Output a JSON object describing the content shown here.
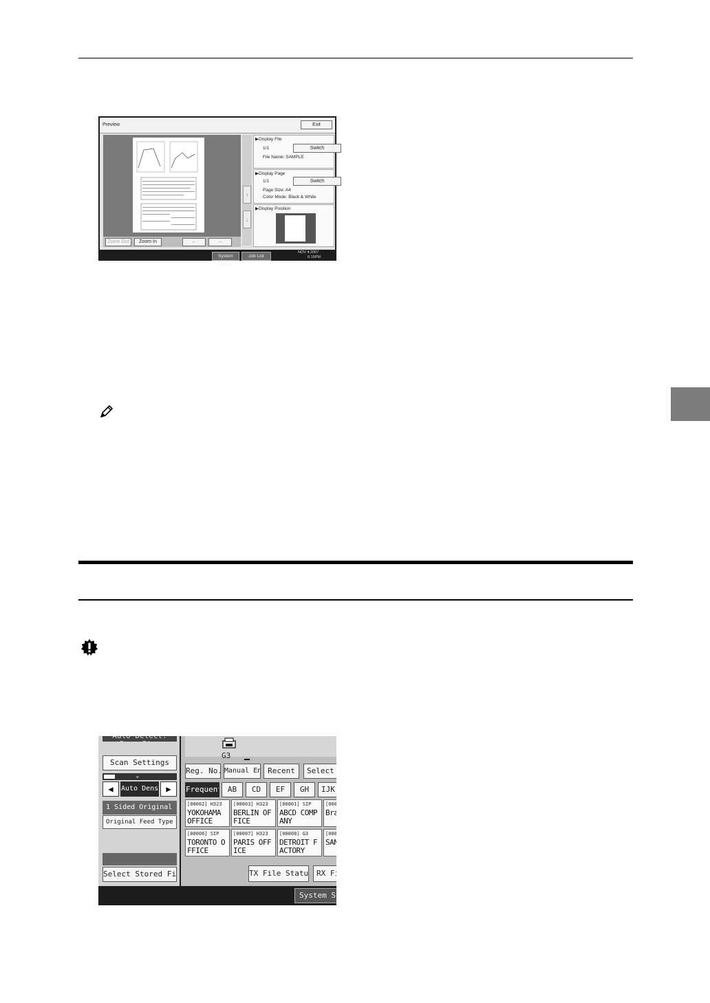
{
  "preview_screen": {
    "title": "Preview",
    "exit_label": "Exit",
    "zoom_out_label": "Zoom Out",
    "zoom_in_label": "Zoom In",
    "prev_arrow": "←",
    "next_arrow": "→",
    "scroll_up": "↑",
    "scroll_down": "↓",
    "display_file": {
      "heading": "Display File",
      "count": "1/1",
      "file_name_label": "File Name:",
      "file_name": "SAMPLE",
      "switch_label": "Switch"
    },
    "display_page": {
      "heading": "Display Page",
      "count": "1/1",
      "page_size_label": "Page Size:",
      "page_size": "A4",
      "color_mode_label": "Color Mode:",
      "color_mode": "Black & White",
      "switch_label": "Switch"
    },
    "display_position": {
      "heading": "Display Position"
    },
    "status_bar": {
      "system_status": "System Status",
      "job_list": "Job List",
      "date": "NOV  4,2007",
      "time": "6:15PM"
    }
  },
  "fax_screen": {
    "top_text": "Auto Detect: Same Size",
    "scan_settings": "Scan Settings",
    "auto_density": "Auto Density",
    "sided_original": "1 Sided Original",
    "original_feed_type": "Original Feed Type",
    "select_stored_file": "Select Stored File",
    "line_mode": "G3",
    "tabs": {
      "reg_no": "Reg. No.",
      "manual_entry": "Manual Entry",
      "recent": "Recent",
      "select_line": "Select Line"
    },
    "index": [
      "Frequent",
      "AB",
      "CD",
      "EF",
      "GH",
      "IJK"
    ],
    "destinations": [
      {
        "code": "[00002] H323",
        "name": "YOKOHAMA OFFICE"
      },
      {
        "code": "[00003] H323",
        "name": "BERLIN OFFICE"
      },
      {
        "code": "[00001] SIP",
        "name": "ABCD COMPANY"
      },
      {
        "code": "[0000",
        "name": "Bra"
      },
      {
        "code": "[00006] SIP",
        "name": "TORONTO OFFICE"
      },
      {
        "code": "[00007] H323",
        "name": "PARIS OFFICE"
      },
      {
        "code": "[00008] G3",
        "name": "DETROIT FACTORY"
      },
      {
        "code": "[0000",
        "name": "SANSCO"
      }
    ],
    "tx_file_status": "TX File Status",
    "rx_file_status": "RX Fi",
    "system_status": "System Statu"
  },
  "colors": {
    "page_background": "#ffffff",
    "side_tab": "#7d7d7d",
    "lcd_dark": "#1c1c1c"
  }
}
